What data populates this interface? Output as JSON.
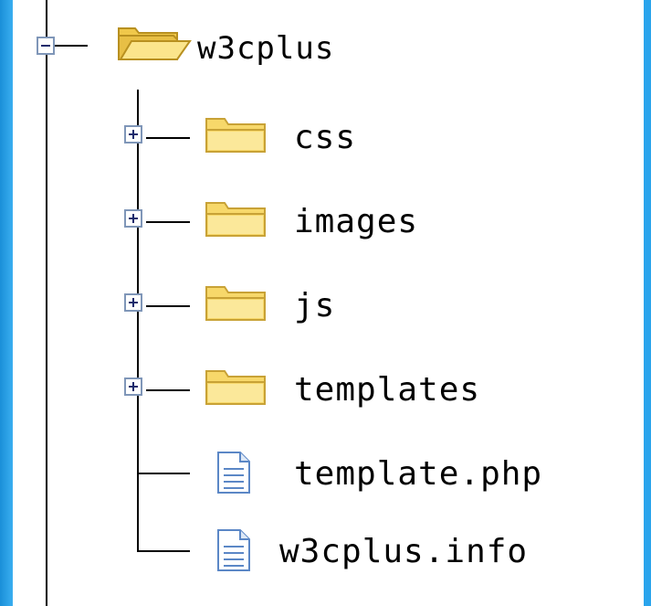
{
  "tree": {
    "root": {
      "label": "w3cplus",
      "expanded": true,
      "icon": "folder-open-icon",
      "children": [
        {
          "label": "css",
          "type": "folder",
          "expanded": false,
          "icon": "folder-icon"
        },
        {
          "label": "images",
          "type": "folder",
          "expanded": false,
          "icon": "folder-icon"
        },
        {
          "label": "js",
          "type": "folder",
          "expanded": false,
          "icon": "folder-icon"
        },
        {
          "label": "templates",
          "type": "folder",
          "expanded": false,
          "icon": "folder-icon"
        },
        {
          "label": "template.php",
          "type": "file",
          "icon": "file-icon"
        },
        {
          "label": "w3cplus.info",
          "type": "file",
          "icon": "file-icon"
        }
      ]
    }
  },
  "colors": {
    "frame": "#2aa4ec",
    "folder_fill": "#f7d86a",
    "folder_stroke": "#c8a236",
    "file_stroke": "#5b87c6"
  }
}
